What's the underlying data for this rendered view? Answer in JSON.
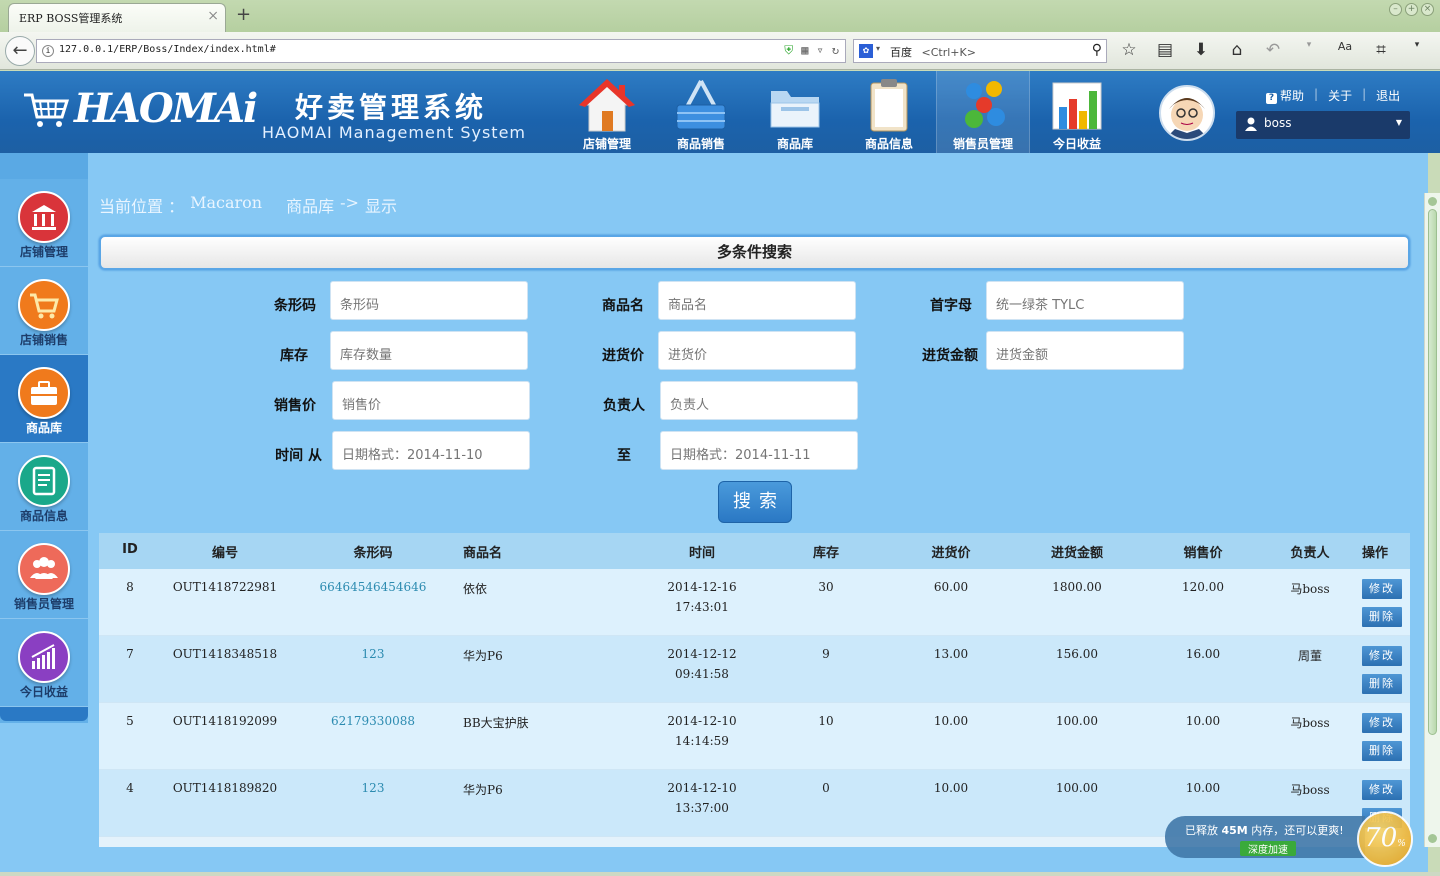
{
  "browser": {
    "tab_title": "ERP BOSS管理系统",
    "url": "127.0.0.1/ERP/Boss/Index/index.html#",
    "search_engine": "百度",
    "search_hint": "<Ctrl+K>"
  },
  "header": {
    "logo_text": "HAOMAi",
    "title": "好卖管理系统",
    "subtitle": "HAOMAI Management System",
    "nav": [
      {
        "label": "店铺管理",
        "icon": "house-icon"
      },
      {
        "label": "商品销售",
        "icon": "shopping-basket-icon"
      },
      {
        "label": "商品库",
        "icon": "folder-icon"
      },
      {
        "label": "商品信息",
        "icon": "clipboard-icon"
      },
      {
        "label": "销售员管理",
        "icon": "people-icon"
      },
      {
        "label": "今日收益",
        "icon": "bar-chart-icon"
      }
    ],
    "links": {
      "help": "帮助",
      "about": "关于",
      "logout": "退出"
    },
    "user": "boss"
  },
  "sidebar": {
    "items": [
      {
        "label": "店铺管理",
        "icon": "bank-icon",
        "color": "#d9343a"
      },
      {
        "label": "店铺销售",
        "icon": "cart-icon",
        "color": "#f07a1c"
      },
      {
        "label": "商品库",
        "icon": "briefcase-icon",
        "color": "#f07a1c"
      },
      {
        "label": "商品信息",
        "icon": "document-icon",
        "color": "#1aa88a"
      },
      {
        "label": "销售员管理",
        "icon": "users-icon",
        "color": "#ee6a5a"
      },
      {
        "label": "今日收益",
        "icon": "chart-icon",
        "color": "#8a3fc2"
      }
    ]
  },
  "breadcrumb": {
    "prefix": "当前位置 ：",
    "site": "Macaron",
    "section": "商品库",
    "arrow": "->",
    "page": "显示"
  },
  "search": {
    "title": "多条件搜索",
    "fields": {
      "barcode": {
        "label": "条形码",
        "placeholder": "条形码"
      },
      "name": {
        "label": "商品名",
        "placeholder": "商品名"
      },
      "initial": {
        "label": "首字母",
        "placeholder": "统一绿茶 TYLC"
      },
      "stock": {
        "label": "库存",
        "placeholder": "库存数量"
      },
      "cost": {
        "label": "进货价",
        "placeholder": "进货价"
      },
      "cost_total": {
        "label": "进货金额",
        "placeholder": "进货金额"
      },
      "price": {
        "label": "销售价",
        "placeholder": "销售价"
      },
      "owner": {
        "label": "负责人",
        "placeholder": "负责人"
      },
      "time_from": {
        "label": "时间 从",
        "placeholder": "日期格式：2014-11-10"
      },
      "time_to": {
        "label": "至",
        "placeholder": "日期格式：2014-11-11"
      }
    },
    "button": "搜索"
  },
  "table": {
    "columns": [
      "ID",
      "编号",
      "条形码",
      "商品名",
      "时间",
      "库存",
      "进货价",
      "进货金额",
      "销售价",
      "负责人",
      "操作"
    ],
    "rows": [
      {
        "id": "8",
        "code": "OUT1418722981",
        "barcode": "66464546454646",
        "name": "依依",
        "date": "2014-12-16",
        "time": "17:43:01",
        "stock": "30",
        "cost": "60.00",
        "cost_total": "1800.00",
        "price": "120.00",
        "owner": "马boss"
      },
      {
        "id": "7",
        "code": "OUT1418348518",
        "barcode": "123",
        "name": "华为P6",
        "date": "2014-12-12",
        "time": "09:41:58",
        "stock": "9",
        "cost": "13.00",
        "cost_total": "156.00",
        "price": "16.00",
        "owner": "周董"
      },
      {
        "id": "5",
        "code": "OUT1418192099",
        "barcode": "62179330088",
        "name": "BB大宝护肤",
        "date": "2014-12-10",
        "time": "14:14:59",
        "stock": "10",
        "cost": "10.00",
        "cost_total": "100.00",
        "price": "10.00",
        "owner": "马boss"
      },
      {
        "id": "4",
        "code": "OUT1418189820",
        "barcode": "123",
        "name": "华为P6",
        "date": "2014-12-10",
        "time": "13:37:00",
        "stock": "0",
        "cost": "10.00",
        "cost_total": "100.00",
        "price": "10.00",
        "owner": "马boss"
      }
    ],
    "edit_label": "修改",
    "delete_label": "删除"
  },
  "toast": {
    "message_pre": "已释放",
    "amount": "45M",
    "message_post": "内存，还可以更爽!",
    "button": "深度加速",
    "gauge_value": "70",
    "gauge_unit": "%"
  }
}
